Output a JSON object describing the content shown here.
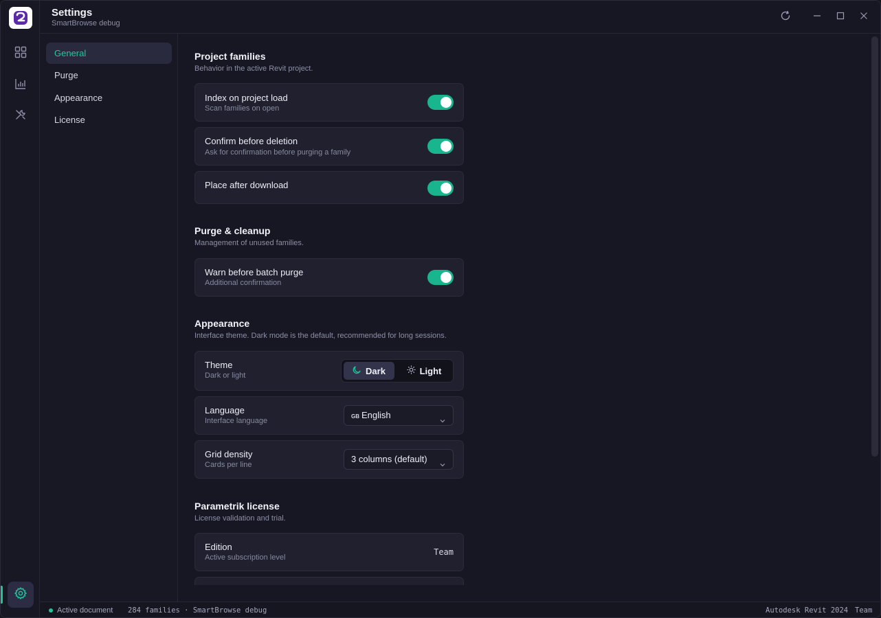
{
  "app": {
    "title": "Settings",
    "subtitle": "SmartBrowse debug"
  },
  "nav": {
    "items": [
      {
        "label": "General",
        "active": true
      },
      {
        "label": "Purge",
        "active": false
      },
      {
        "label": "Appearance",
        "active": false
      },
      {
        "label": "License",
        "active": false
      }
    ]
  },
  "sections": {
    "project": {
      "title": "Project families",
      "subtitle": "Behavior in the active Revit project.",
      "rows": [
        {
          "title": "Index on project load",
          "subtitle": "Scan families on open",
          "enabled": true
        },
        {
          "title": "Confirm before deletion",
          "subtitle": "Ask for confirmation before purging a family",
          "enabled": true
        },
        {
          "title": "Place after download",
          "subtitle": "",
          "enabled": true
        }
      ]
    },
    "purge": {
      "title": "Purge & cleanup",
      "subtitle": "Management of unused families.",
      "rows": [
        {
          "title": "Warn before batch purge",
          "subtitle": "Additional confirmation",
          "enabled": true
        }
      ]
    },
    "appearance": {
      "title": "Appearance",
      "subtitle": "Interface theme. Dark mode is the default, recommended for long sessions.",
      "theme": {
        "title": "Theme",
        "subtitle": "Dark or light",
        "options": [
          "Dark",
          "Light"
        ],
        "selected": "Dark"
      },
      "language": {
        "title": "Language",
        "subtitle": "Interface language",
        "flag": "GB",
        "value": "English"
      },
      "density": {
        "title": "Grid density",
        "subtitle": "Cards per line",
        "value": "3 columns (default)"
      }
    },
    "license": {
      "title": "Parametrik license",
      "subtitle": "License validation and trial.",
      "edition": {
        "title": "Edition",
        "subtitle": "Active subscription level",
        "value": "Team"
      }
    }
  },
  "status": {
    "active_doc": "Active document",
    "families": "284 families · SmartBrowse debug",
    "host": "Autodesk Revit 2024",
    "plan": "Team"
  },
  "colors": {
    "accent": "#1fc49a",
    "background": "#171723",
    "card": "#20202f"
  },
  "icons": {
    "rail": [
      "grid-icon",
      "chart-icon",
      "tools-icon",
      "gear-icon"
    ],
    "titlebar": [
      "refresh-icon",
      "minimize-icon",
      "maximize-icon",
      "close-icon"
    ]
  }
}
